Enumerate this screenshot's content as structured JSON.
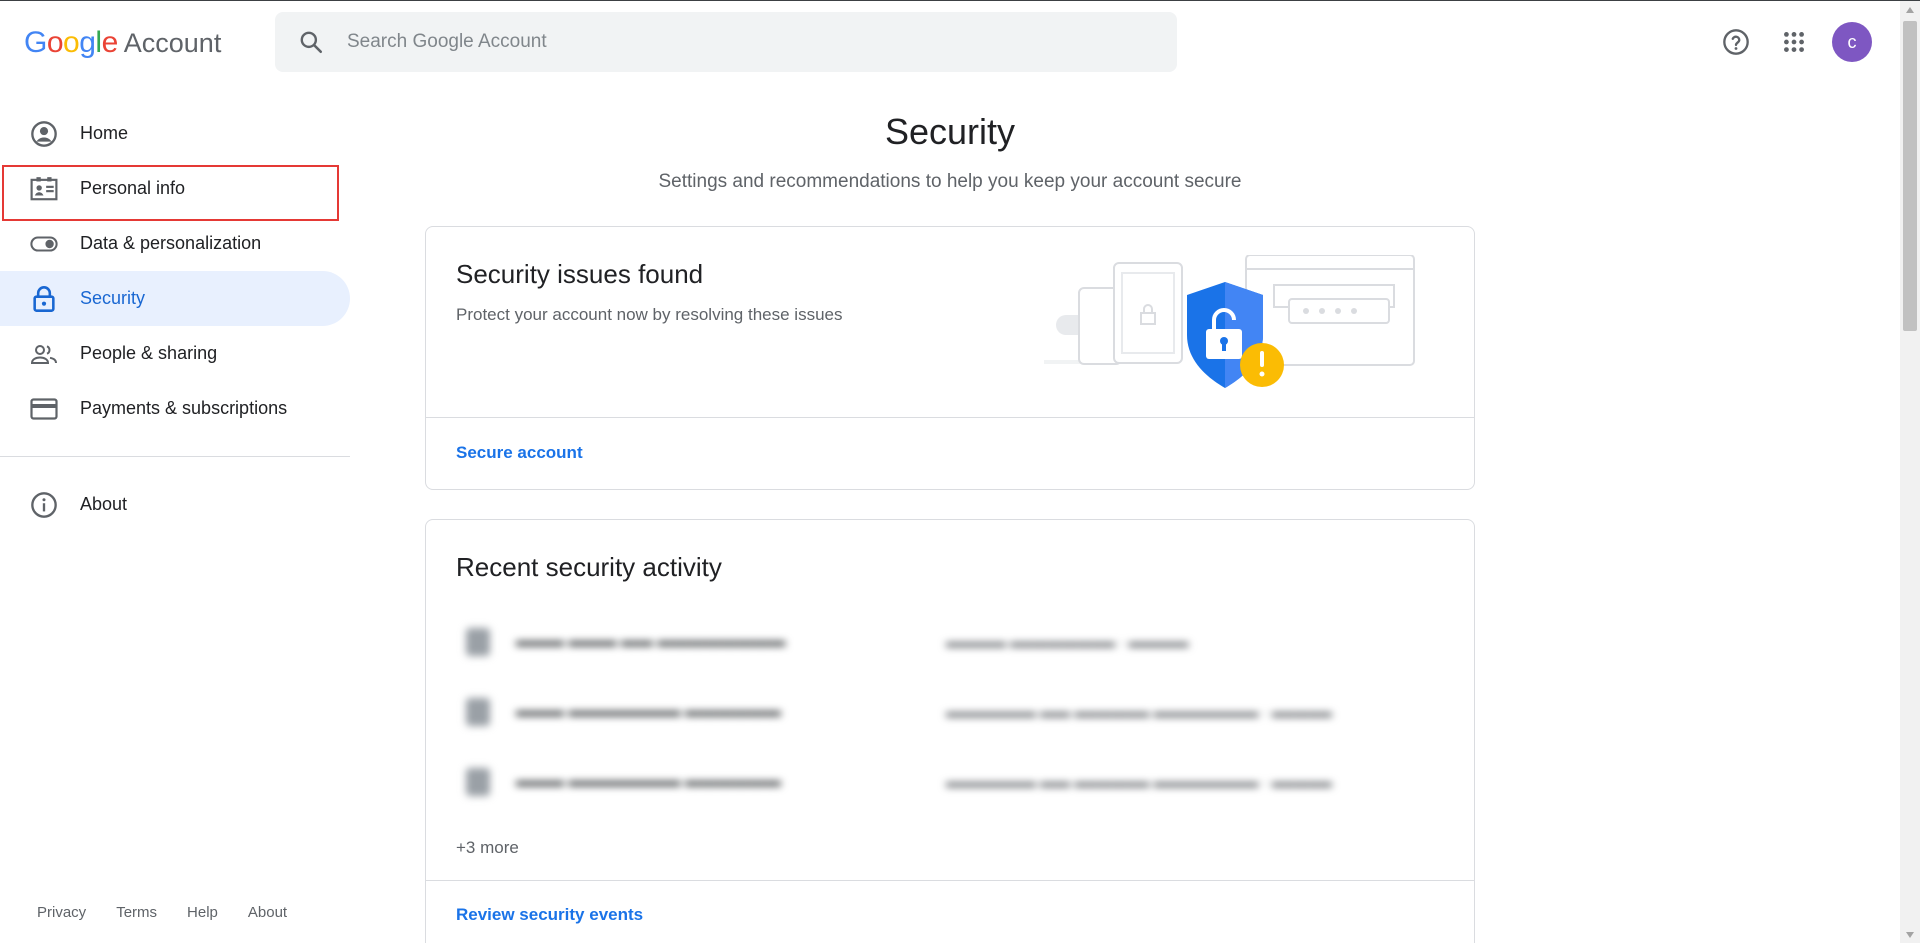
{
  "header": {
    "logo_google_letters": [
      "G",
      "o",
      "o",
      "g",
      "l",
      "e"
    ],
    "logo_product": "Account",
    "search_placeholder": "Search Google Account",
    "avatar_initial": "c",
    "icons": [
      "search-icon",
      "help-icon",
      "apps-grid-icon"
    ]
  },
  "sidebar": {
    "items": [
      {
        "label": "Home",
        "icon": "account-circle-icon"
      },
      {
        "label": "Personal info",
        "icon": "id-card-icon"
      },
      {
        "label": "Data & personalization",
        "icon": "toggle-icon"
      },
      {
        "label": "Security",
        "icon": "lock-icon",
        "active": true
      },
      {
        "label": "People & sharing",
        "icon": "people-icon"
      },
      {
        "label": "Payments & subscriptions",
        "icon": "credit-card-icon"
      }
    ],
    "about": {
      "label": "About",
      "icon": "info-icon"
    },
    "footer": [
      "Privacy",
      "Terms",
      "Help",
      "About"
    ]
  },
  "main": {
    "title": "Security",
    "subtitle": "Settings and recommendations to help you keep your account secure",
    "issues_card": {
      "title": "Security issues found",
      "description": "Protect your account now by resolving these issues",
      "link": "Secure account"
    },
    "activity_card": {
      "title": "Recent security activity",
      "more": "+3 more",
      "link": "Review security events"
    }
  },
  "colors": {
    "accent": "#1a73e8",
    "active_bg": "#e8f0fe",
    "highlight_border": "#e53935",
    "avatar": "#7e57c2",
    "warning": "#fbbc04"
  }
}
